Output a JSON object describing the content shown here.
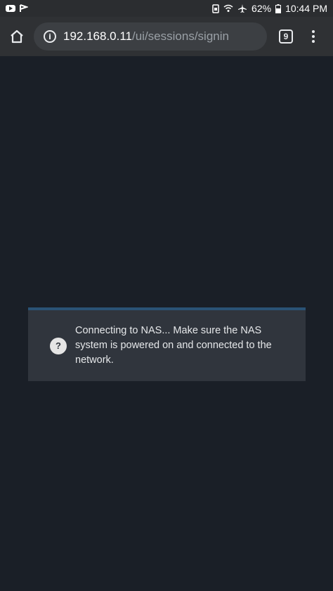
{
  "status_bar": {
    "battery": "62%",
    "time": "10:44 PM"
  },
  "browser": {
    "url_host": "192.168.0.11",
    "url_path": "/ui/sessions/signin",
    "tab_count": "9"
  },
  "notice": {
    "icon_glyph": "?",
    "message": "Connecting to NAS... Make sure the NAS system is powered on and connected to the network."
  },
  "colors": {
    "background": "#1a1f27",
    "notice_bg": "#30353d",
    "notice_accent": "#2a5275"
  }
}
